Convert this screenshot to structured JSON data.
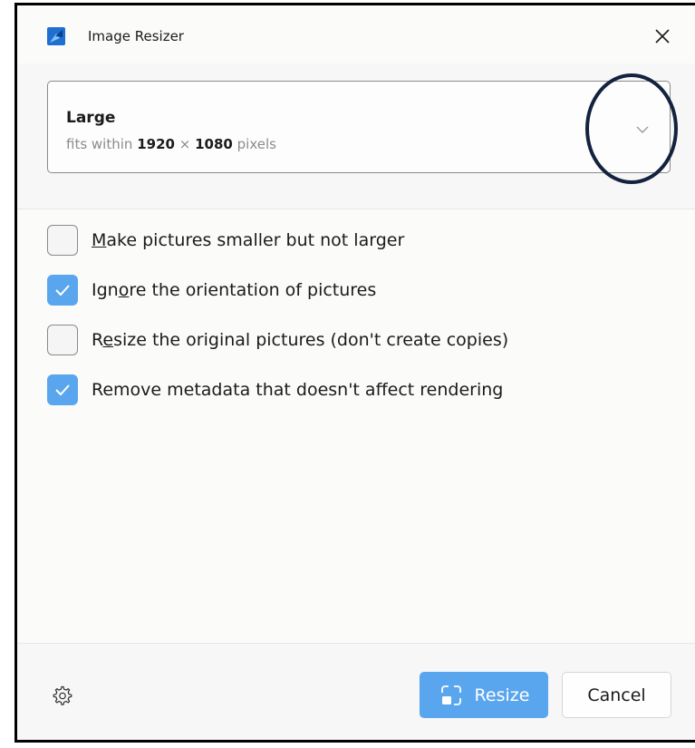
{
  "window": {
    "title": "Image Resizer",
    "icon": "image-resizer-app-icon",
    "close_icon": "close-icon"
  },
  "size_selector": {
    "name": "Large",
    "desc_prefix": "fits within",
    "width": "1920",
    "times": "×",
    "height": "1080",
    "unit": "pixels",
    "chevron_icon": "chevron-down-icon"
  },
  "options": [
    {
      "pre": "",
      "key": "M",
      "post": "ake pictures smaller but not larger",
      "checked": false
    },
    {
      "pre": "Ign",
      "key": "o",
      "post": "re the orientation of pictures",
      "checked": true
    },
    {
      "pre": "R",
      "key": "e",
      "post": "size the original pictures (don't create copies)",
      "checked": false
    },
    {
      "pre": "",
      "key": "",
      "post": "Remove metadata that doesn't affect rendering",
      "checked": true
    }
  ],
  "footer": {
    "settings_icon": "gear-icon",
    "resize_label": "Resize",
    "cancel_label": "Cancel"
  },
  "colors": {
    "accent": "#5aa6ee",
    "highlight_ring": "#13223e"
  }
}
